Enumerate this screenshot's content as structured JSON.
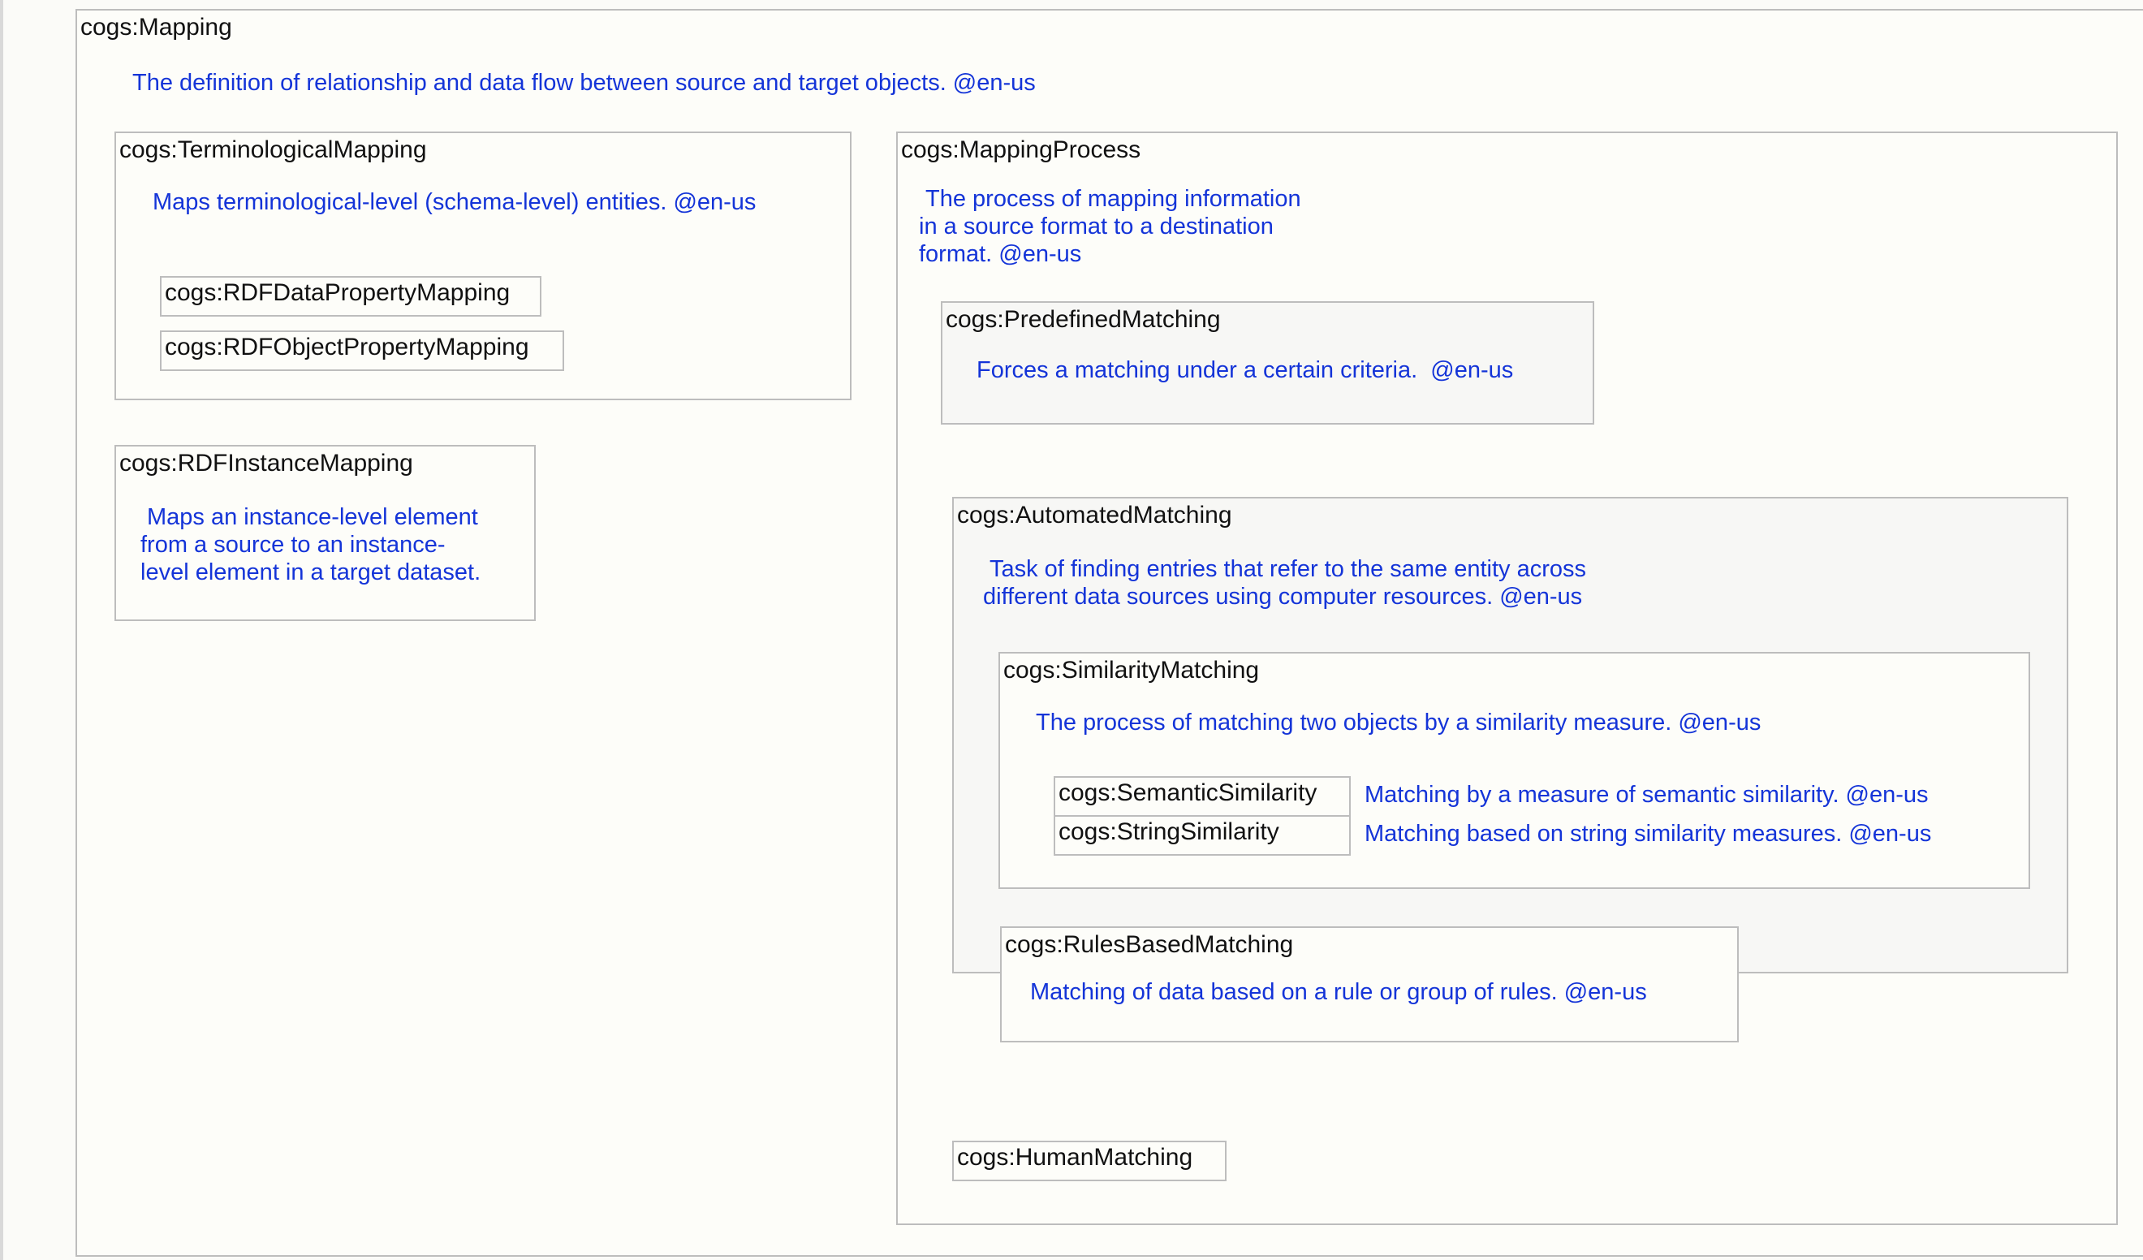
{
  "mapping": {
    "label": "cogs:Mapping",
    "description": "The definition of relationship and data flow between source and target objects. @en-us"
  },
  "terminological": {
    "label": "cogs:TerminologicalMapping",
    "description": "Maps terminological-level (schema-level) entities. @en-us",
    "children": [
      "cogs:RDFDataPropertyMapping",
      "cogs:RDFObjectPropertyMapping"
    ]
  },
  "instance": {
    "label": "cogs:RDFInstanceMapping",
    "description_lines": [
      "Maps an instance-level element",
      "from a source to an instance-",
      "level element in a target dataset."
    ]
  },
  "process": {
    "label": "cogs:MappingProcess",
    "description_lines": [
      "The process of mapping information",
      "in a source format to a destination",
      "format. @en-us"
    ]
  },
  "predefined": {
    "label": "cogs:PredefinedMatching",
    "description": "Forces a matching under a certain criteria.  @en-us"
  },
  "automated": {
    "label": "cogs:AutomatedMatching",
    "description_lines": [
      "Task of finding entries that refer to the same entity across",
      "different data sources using computer resources. @en-us"
    ]
  },
  "similarity": {
    "label": "cogs:SimilarityMatching",
    "description": "The process of matching two objects by a similarity measure. @en-us",
    "semantic": {
      "label": "cogs:SemanticSimilarity",
      "description": "Matching by a measure of semantic similarity. @en-us"
    },
    "string": {
      "label": "cogs:StringSimilarity",
      "description": "Matching based on string similarity measures. @en-us"
    }
  },
  "rules": {
    "label": "cogs:RulesBasedMatching",
    "description": "Matching of data based on a rule or group of rules. @en-us"
  },
  "human": {
    "label": "cogs:HumanMatching"
  }
}
